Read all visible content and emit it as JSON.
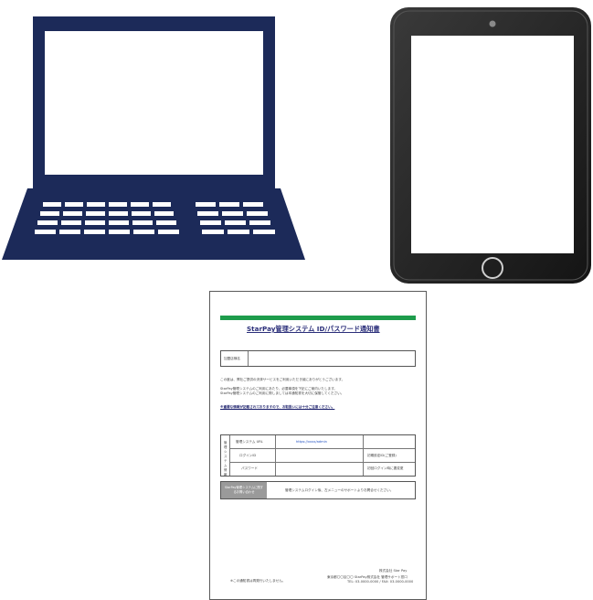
{
  "colors": {
    "laptop_navy": "#1c2a59",
    "tablet_body": "#2b2b2b",
    "doc_header_bar": "#1e9c4c",
    "doc_box_gray": "#9a9a9a"
  },
  "icons": {
    "laptop": "laptop-icon",
    "tablet": "tablet-icon"
  },
  "document": {
    "title": "StarPay管理システム ID/パスワード通知書",
    "recipient_label": "加盟店様名",
    "intro_line1": "この度は、弊社ご提供の決済サービスをご利用いただき誠にありがとうございます。",
    "intro_line2": "StarPay管理システムのご利用にあたり、必要事項を下記にご案内いたします。",
    "intro_line3": "StarPay管理システムのご利用に際しましては本通知書を大切に保管してください。",
    "notice": "※重要な情報が記載されておりますので、お取扱いには十分ご注意ください。",
    "table_side_label": "管理システム情報",
    "row1_label": "管理システム URL",
    "row1_value": "https://xxxx/admin",
    "row2_label": "ログインID",
    "row2_note": "初期設定ID(ご登録)",
    "row3_label": "パスワード",
    "row3_note": "初回ログイン時に要変更",
    "support_label": "StarPay管理システムに関するお問い合わせ",
    "support_text": "管理システムログイン後、左メニューのサポートよりお問合せください。",
    "footer_left": "※この通知書は再発行いたしません。",
    "footer_company": "株式会社 Star Pay",
    "footer_line1": "東京都〇〇区〇〇 StarPay株式会社 管理サポート窓口",
    "footer_line2": "TEL: 03-0000-0000 / FAX: 03-0000-0000"
  }
}
